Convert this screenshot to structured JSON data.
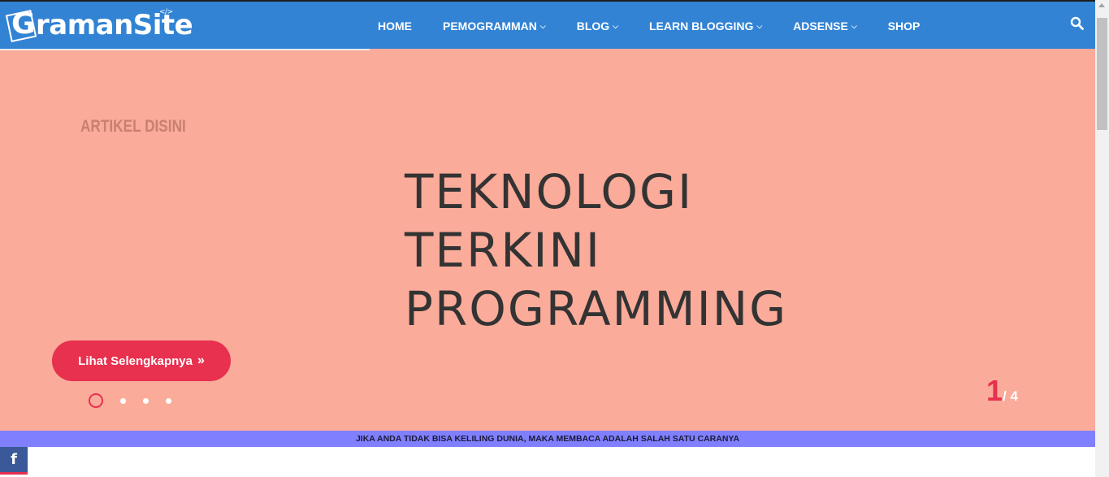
{
  "brand": {
    "name_prefix": "G",
    "name_rest": "ramanSite",
    "code_mark": "</>"
  },
  "nav": {
    "items": [
      {
        "label": "HOME",
        "has_dropdown": false
      },
      {
        "label": "PEMOGRAMMAN",
        "has_dropdown": true
      },
      {
        "label": "BLOG",
        "has_dropdown": true
      },
      {
        "label": "LEARN BLOGGING",
        "has_dropdown": true
      },
      {
        "label": "ADSENSE",
        "has_dropdown": true
      },
      {
        "label": "SHOP",
        "has_dropdown": false
      }
    ],
    "search_icon": "search-icon"
  },
  "hero": {
    "kicker": "ARTIKEL DISINI",
    "headline_lines": [
      "TEKNOLOGI",
      "TERKINI",
      "PROGRAMMING"
    ],
    "cta_label": "Lihat Selengkapnya",
    "cta_icon": "double-chevron-right-icon",
    "slide_current": "1",
    "slide_total": "/ 4",
    "slides_count": 4,
    "active_slide": 1
  },
  "ticker": {
    "text": "JIKA ANDA TIDAK BISA KELILING DUNIA, MAKA MEMBACA ADALAH SALAH SATU CARANYA"
  },
  "social": {
    "facebook_label": "f"
  },
  "colors": {
    "topbar": "#3283d4",
    "hero_bg": "#faab99",
    "accent": "#e8304f",
    "ticker_bg": "#8080ff",
    "facebook": "#3b5998"
  }
}
